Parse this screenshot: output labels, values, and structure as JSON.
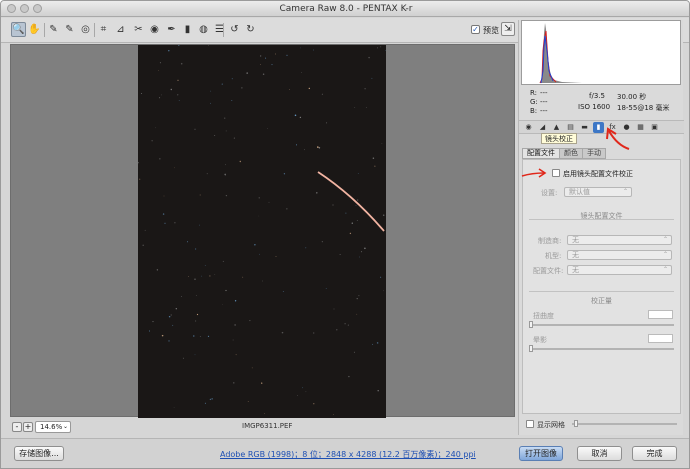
{
  "window": {
    "title": "Camera Raw 8.0 -  PENTAX K-r"
  },
  "toolbar": {
    "tools": [
      {
        "icon": "zoom-icon",
        "glyph": "🔍"
      },
      {
        "icon": "hand-icon",
        "glyph": "✋"
      },
      {
        "icon": "white-balance-icon",
        "glyph": "✎"
      },
      {
        "icon": "color-sampler-icon",
        "glyph": "✎"
      },
      {
        "icon": "target-adjust-icon",
        "glyph": "◎"
      },
      {
        "icon": "crop-icon",
        "glyph": "⌗"
      },
      {
        "icon": "straighten-icon",
        "glyph": "⊿"
      },
      {
        "icon": "spot-removal-icon",
        "glyph": "✂"
      },
      {
        "icon": "red-eye-icon",
        "glyph": "◉"
      },
      {
        "icon": "adjustment-brush-icon",
        "glyph": "✒"
      },
      {
        "icon": "graduated-filter-icon",
        "glyph": "▮"
      },
      {
        "icon": "radial-filter-icon",
        "glyph": "◍"
      },
      {
        "icon": "preferences-icon",
        "glyph": "☰"
      },
      {
        "icon": "rotate-left-icon",
        "glyph": "↺"
      },
      {
        "icon": "rotate-right-icon",
        "glyph": "↻"
      }
    ],
    "preview_label": "预览",
    "preview_checked": true
  },
  "histogram": {
    "r_label": "R:",
    "g_label": "G:",
    "b_label": "B:",
    "r_value": "---",
    "g_value": "---",
    "b_value": "---",
    "aperture": "f/3.5",
    "shutter": "30.00 秒",
    "iso": "ISO 1600",
    "lens": "18-55@18 毫米"
  },
  "panel_tabs": [
    {
      "icon": "basic-icon",
      "glyph": "◉"
    },
    {
      "icon": "tone-curve-icon",
      "glyph": "◢"
    },
    {
      "icon": "detail-icon",
      "glyph": "▲"
    },
    {
      "icon": "hsl-icon",
      "glyph": "▤"
    },
    {
      "icon": "split-toning-icon",
      "glyph": "▬"
    },
    {
      "icon": "lens-corrections-icon",
      "glyph": "▮"
    },
    {
      "icon": "effects-icon",
      "glyph": "fx"
    },
    {
      "icon": "camera-calibration-icon",
      "glyph": "●"
    },
    {
      "icon": "presets-icon",
      "glyph": "▦"
    },
    {
      "icon": "snapshots-icon",
      "glyph": "▣"
    }
  ],
  "tooltip": "镜头校正",
  "subtabs": [
    "配置文件",
    "颜色",
    "手动"
  ],
  "lens_panel": {
    "enable_label": "启用镜头配置文件校正",
    "setup_label": "设置:",
    "setup_value": "默认值",
    "profile_heading": "镜头配置文件",
    "make_label": "制造商:",
    "make_value": "无",
    "model_label": "机型:",
    "model_value": "无",
    "profile_label": "配置文件:",
    "profile_value": "无",
    "amount_heading": "校正量",
    "distortion_label": "扭曲度",
    "vignetting_label": "晕影"
  },
  "grid_label": "显示网格",
  "zoom": {
    "minus": "-",
    "plus": "+",
    "value": "14.6%"
  },
  "filename": "IMGP6311.PEF",
  "bottom": {
    "save_label": "存储图像...",
    "workflow_link": "Adobe RGB (1998)；8 位；2848 x 4288 (12.2 百万像素)；240 ppi",
    "open_label": "打开图像",
    "cancel_label": "取消",
    "done_label": "完成"
  }
}
